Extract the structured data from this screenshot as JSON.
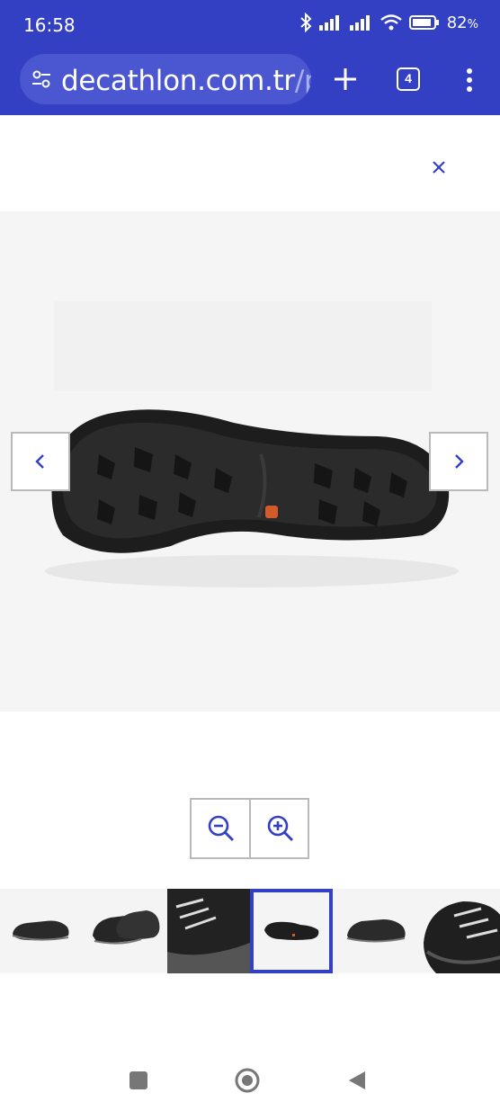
{
  "status": {
    "time": "16:58",
    "battery": "82"
  },
  "browser": {
    "url_main": "decathlon.com.tr",
    "url_rest": "/p",
    "tab_count": "4"
  },
  "gallery": {
    "current_image": "shoe-sole",
    "thumbnails": [
      "shoe-side",
      "shoe-pair",
      "shoe-laces-closeup",
      "shoe-sole",
      "shoe-side-2",
      "shoe-front-closeup"
    ],
    "active_index": 3
  },
  "colors": {
    "accent": "#3340c4",
    "page_bg": "#ffffff",
    "image_bg": "#f5f5f5",
    "border": "#b9b9b9",
    "sole_accent": "#d25a2b"
  }
}
